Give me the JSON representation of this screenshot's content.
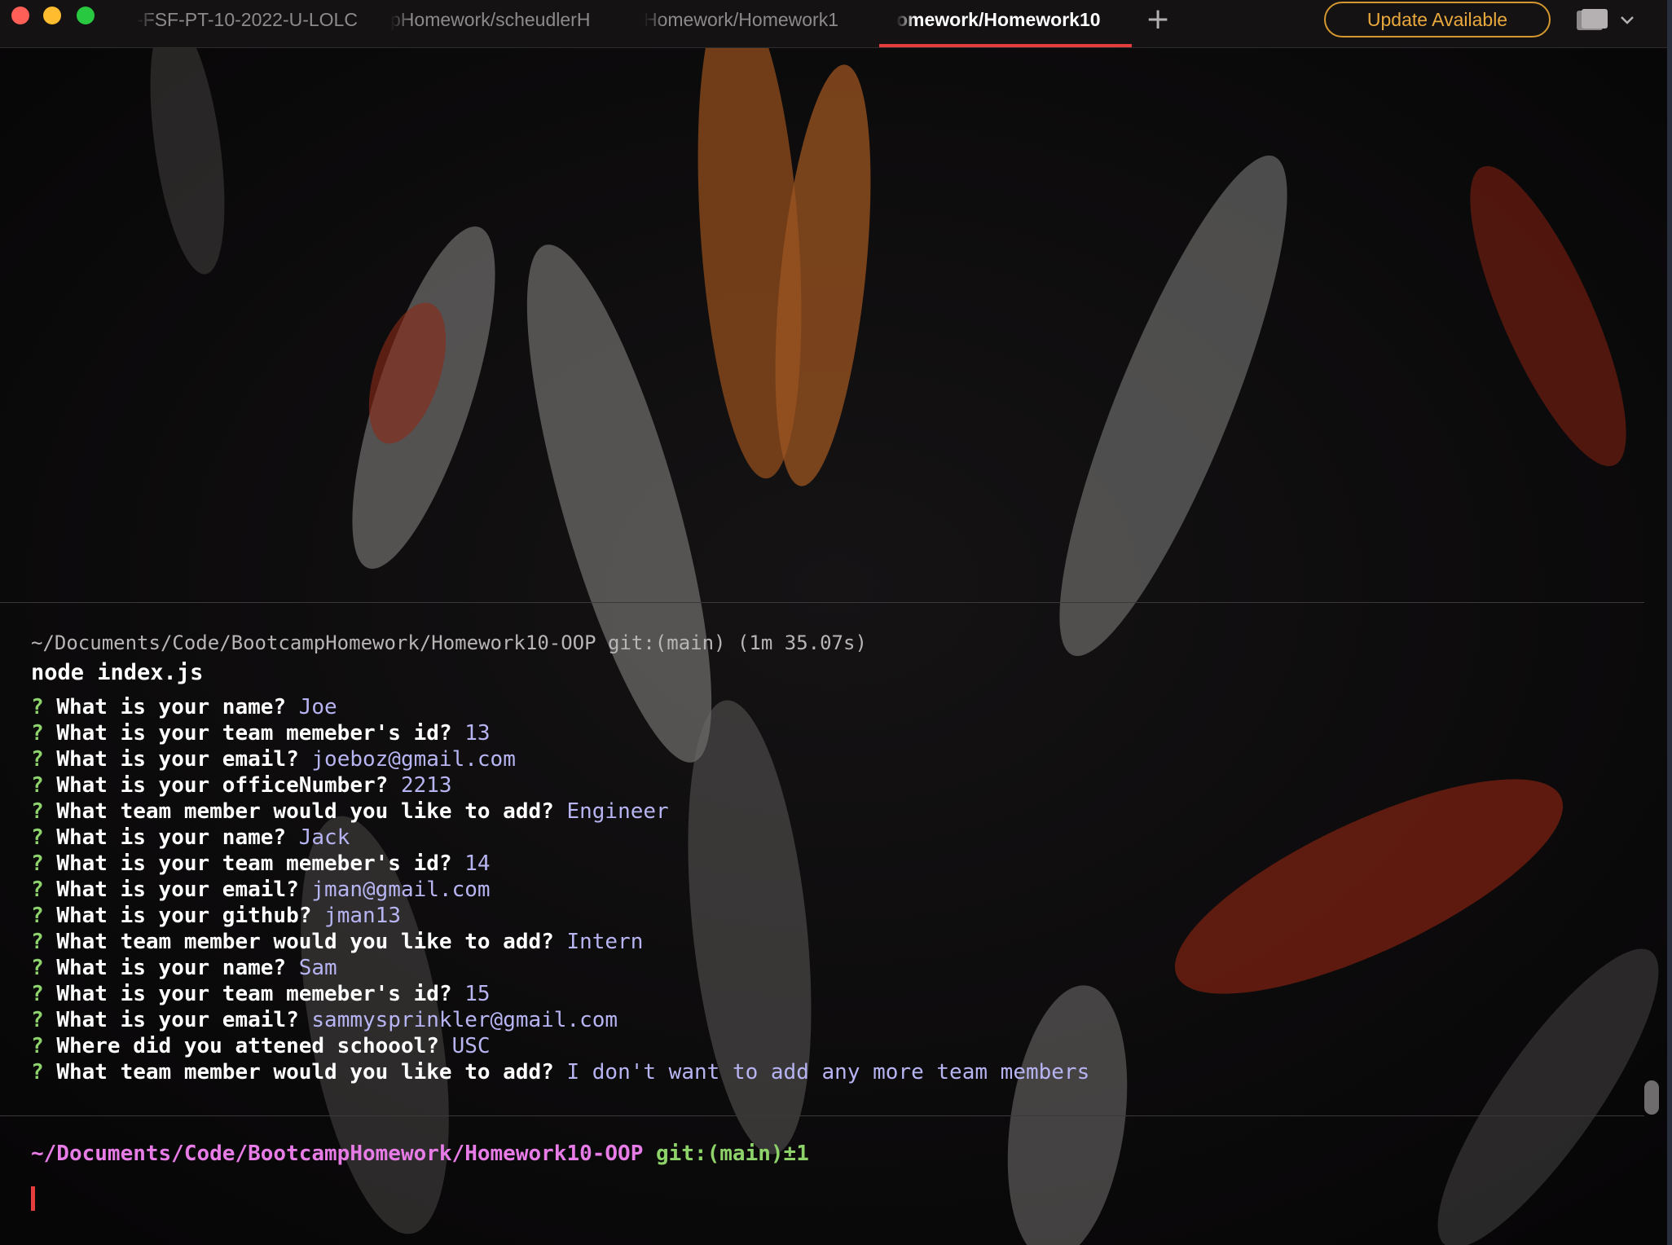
{
  "window": {
    "tabs": [
      {
        "label": "-FSF-PT-10-2022-U-LOLC",
        "active": false
      },
      {
        "label": "pHomework/scheudlerH",
        "active": false
      },
      {
        "label": "Homework/Homework1",
        "active": false
      },
      {
        "label": "omework/Homework10",
        "active": true
      }
    ],
    "new_tab_symbol": "+",
    "update_label": "Update Available",
    "accent_color": "#e33d3d",
    "update_color": "#e9a93c",
    "icons": [
      "close-icon",
      "minimize-icon",
      "zoom-icon",
      "plus-icon",
      "window-layout-icon",
      "chevron-down-icon"
    ]
  },
  "terminal": {
    "previous_block": {
      "meta": "~/Documents/Code/BootcampHomework/Homework10-OOP git:(main) (1m 35.07s)",
      "command": "node index.js",
      "prompt_mark": "?",
      "lines": [
        {
          "q": "What is your name?",
          "a": "Joe"
        },
        {
          "q": "What is your team memeber's id?",
          "a": "13"
        },
        {
          "q": "What is your email?",
          "a": "joeboz@gmail.com"
        },
        {
          "q": "What is your officeNumber?",
          "a": "2213"
        },
        {
          "q": "What team member would you like to add?",
          "a": "Engineer"
        },
        {
          "q": "What is your name?",
          "a": "Jack"
        },
        {
          "q": "What is your team memeber's id?",
          "a": "14"
        },
        {
          "q": "What is your email?",
          "a": "jman@gmail.com"
        },
        {
          "q": "What is your github?",
          "a": "jman13"
        },
        {
          "q": "What team member would you like to add?",
          "a": "Intern"
        },
        {
          "q": "What is your name?",
          "a": "Sam"
        },
        {
          "q": "What is your team memeber's id?",
          "a": "15"
        },
        {
          "q": "What is your email?",
          "a": "sammysprinkler@gmail.com"
        },
        {
          "q": "Where did you attened schoool?",
          "a": "USC"
        },
        {
          "q": "What team member would you like to add?",
          "a": "I don't want to add any more team members"
        }
      ]
    },
    "prompt": {
      "path": "~/Documents/Code/BootcampHomework/Homework10-OOP",
      "git": "git:(main)±1"
    }
  }
}
